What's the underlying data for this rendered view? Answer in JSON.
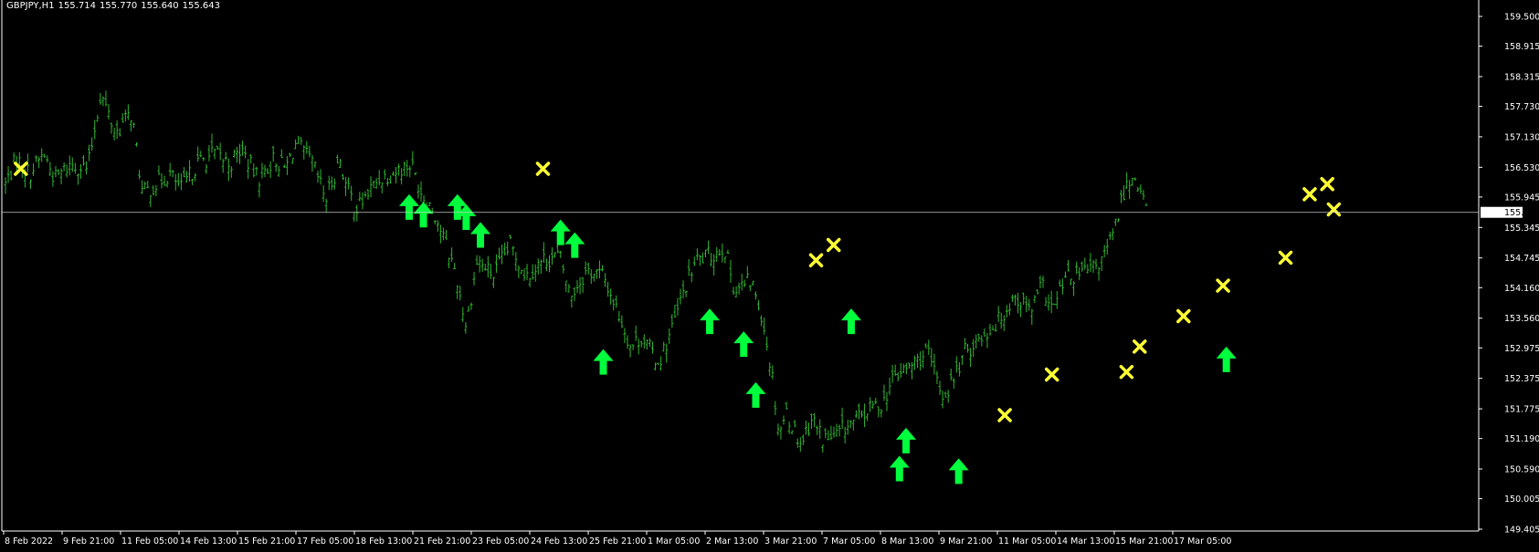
{
  "header": {
    "symbol_tf": "GBPJPY,H1",
    "open": "155.714",
    "high": "155.770",
    "low": "155.640",
    "close": "155.643"
  },
  "colors": {
    "background": "#000000",
    "bars": "#2fb52f",
    "axis": "#ffffff",
    "buy_arrow": "#00ff3c",
    "cross": "#ffff33",
    "price_line": "#c8c8c8"
  },
  "chart_data": {
    "type": "ohlc-bars",
    "symbol": "GBPJPY",
    "timeframe": "H1",
    "current_price": "155.643",
    "ylim": [
      149.3,
      160.0
    ],
    "y_ticks": [
      "159.500",
      "158.915",
      "158.315",
      "157.730",
      "157.130",
      "156.530",
      "155.945",
      "155.345",
      "154.745",
      "154.160",
      "153.560",
      "152.975",
      "152.375",
      "151.775",
      "151.190",
      "150.590",
      "150.005",
      "149.405"
    ],
    "x_ticks": [
      "8 Feb 2022",
      "9 Feb 21:00",
      "11 Feb 05:00",
      "14 Feb 13:00",
      "15 Feb 21:00",
      "17 Feb 05:00",
      "18 Feb 13:00",
      "21 Feb 21:00",
      "23 Feb 05:00",
      "24 Feb 13:00",
      "25 Feb 21:00",
      "1 Mar 05:00",
      "2 Mar 13:00",
      "3 Mar 21:00",
      "7 Mar 05:00",
      "8 Mar 13:00",
      "9 Mar 21:00",
      "11 Mar 05:00",
      "14 Mar 13:00",
      "15 Mar 21:00",
      "17 Mar 05:00"
    ],
    "bar_count": 410,
    "price_path": [
      [
        0,
        156.2
      ],
      [
        10,
        156.7
      ],
      [
        22,
        156.4
      ],
      [
        35,
        156.8
      ],
      [
        45,
        156.3
      ],
      [
        60,
        156.6
      ],
      [
        75,
        156.5
      ],
      [
        87,
        158.0
      ],
      [
        100,
        157.2
      ],
      [
        115,
        157.6
      ],
      [
        125,
        156.0
      ],
      [
        150,
        156.4
      ],
      [
        160,
        156.1
      ],
      [
        175,
        156.6
      ],
      [
        190,
        156.8
      ],
      [
        205,
        156.6
      ],
      [
        215,
        156.9
      ],
      [
        230,
        156.3
      ],
      [
        245,
        156.7
      ],
      [
        255,
        156.5
      ],
      [
        265,
        157.0
      ],
      [
        280,
        156.6
      ],
      [
        292,
        155.9
      ],
      [
        305,
        156.7
      ],
      [
        310,
        156.2
      ],
      [
        320,
        155.7
      ],
      [
        340,
        156.3
      ],
      [
        360,
        156.5
      ],
      [
        370,
        156.6
      ],
      [
        380,
        156.0
      ],
      [
        390,
        155.7
      ],
      [
        410,
        154.5
      ],
      [
        420,
        153.4
      ],
      [
        430,
        154.7
      ],
      [
        445,
        154.4
      ],
      [
        460,
        155.0
      ],
      [
        475,
        154.4
      ],
      [
        490,
        154.7
      ],
      [
        505,
        154.8
      ],
      [
        515,
        154.0
      ],
      [
        530,
        154.5
      ],
      [
        545,
        154.4
      ],
      [
        560,
        153.6
      ],
      [
        570,
        153.0
      ],
      [
        580,
        153.2
      ],
      [
        595,
        152.7
      ],
      [
        600,
        152.9
      ],
      [
        610,
        153.5
      ],
      [
        620,
        154.2
      ],
      [
        630,
        154.7
      ],
      [
        645,
        154.8
      ],
      [
        655,
        155.0
      ],
      [
        665,
        154.1
      ],
      [
        680,
        154.3
      ],
      [
        690,
        153.6
      ],
      [
        700,
        152.3
      ],
      [
        705,
        151.3
      ],
      [
        712,
        151.7
      ],
      [
        725,
        151.1
      ],
      [
        735,
        151.6
      ],
      [
        745,
        151.2
      ],
      [
        755,
        151.2
      ],
      [
        765,
        151.4
      ],
      [
        780,
        151.6
      ],
      [
        790,
        151.8
      ],
      [
        800,
        151.9
      ],
      [
        810,
        152.4
      ],
      [
        825,
        152.6
      ],
      [
        840,
        152.9
      ],
      [
        850,
        152.3
      ],
      [
        855,
        152.0
      ],
      [
        865,
        152.4
      ],
      [
        875,
        152.9
      ],
      [
        890,
        153.2
      ],
      [
        905,
        153.5
      ],
      [
        920,
        154.0
      ],
      [
        935,
        153.7
      ],
      [
        945,
        154.2
      ],
      [
        955,
        153.7
      ],
      [
        965,
        154.3
      ],
      [
        975,
        154.4
      ],
      [
        990,
        154.5
      ],
      [
        1000,
        154.7
      ],
      [
        1010,
        155.2
      ],
      [
        1020,
        156.1
      ],
      [
        1030,
        156.4
      ],
      [
        1040,
        155.7
      ]
    ],
    "buy_signals": [
      {
        "bar": 368,
        "price": 156.0
      },
      {
        "bar": 381,
        "price": 155.85
      },
      {
        "bar": 412,
        "price": 156.0
      },
      {
        "bar": 420,
        "price": 155.8
      },
      {
        "bar": 433,
        "price": 155.45
      },
      {
        "bar": 506,
        "price": 155.5
      },
      {
        "bar": 519,
        "price": 155.25
      },
      {
        "bar": 545,
        "price": 152.95
      },
      {
        "bar": 642,
        "price": 153.75
      },
      {
        "bar": 673,
        "price": 153.3
      },
      {
        "bar": 684,
        "price": 152.3
      },
      {
        "bar": 771,
        "price": 153.75
      },
      {
        "bar": 815,
        "price": 150.85
      },
      {
        "bar": 821,
        "price": 151.4
      },
      {
        "bar": 869,
        "price": 150.8
      },
      {
        "bar": 1113,
        "price": 153.0
      }
    ],
    "cross_signals": [
      {
        "bar": 14,
        "price": 156.5
      },
      {
        "bar": 490,
        "price": 156.5
      },
      {
        "bar": 739,
        "price": 154.7
      },
      {
        "bar": 755,
        "price": 155.0
      },
      {
        "bar": 911,
        "price": 151.65
      },
      {
        "bar": 954,
        "price": 152.45
      },
      {
        "bar": 1022,
        "price": 152.5
      },
      {
        "bar": 1034,
        "price": 153.0
      },
      {
        "bar": 1074,
        "price": 153.6
      },
      {
        "bar": 1110,
        "price": 154.2
      },
      {
        "bar": 1167,
        "price": 154.75
      },
      {
        "bar": 1189,
        "price": 156.0
      },
      {
        "bar": 1205,
        "price": 156.2
      },
      {
        "bar": 1211,
        "price": 155.7
      }
    ]
  }
}
